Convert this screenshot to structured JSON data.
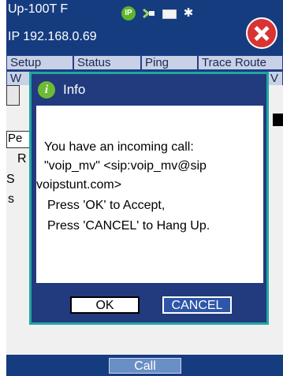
{
  "header": {
    "title": "Up-100T F",
    "ip": "IP 192.168.0.69",
    "status_icons": [
      "ip-icon",
      "plug-icon",
      "battery-icon",
      "bluetooth-icon"
    ],
    "ip_icon_label": "IP"
  },
  "tabs_row1": [
    "Setup",
    "Status",
    "Ping",
    "Trace Route"
  ],
  "tabs_row2": [
    "W",
    "V"
  ],
  "background": {
    "field_prefix": "Pe",
    "lines": [
      "R",
      "S",
      "s"
    ]
  },
  "bottom": {
    "call_label": "Call"
  },
  "dialog": {
    "title": "Info",
    "message_lines": [
      "You have an incoming call:",
      "\"voip_mv\" <sip:voip_mv@sip",
      "voipstunt.com>",
      "Press 'OK' to Accept,",
      "Press 'CANCEL' to Hang Up."
    ],
    "ok_label": "OK",
    "cancel_label": "CANCEL"
  },
  "colors": {
    "header_blue": "#163c80",
    "dialog_border": "#20a7a0",
    "close_red": "#d93333",
    "info_green": "#6dbb35"
  }
}
